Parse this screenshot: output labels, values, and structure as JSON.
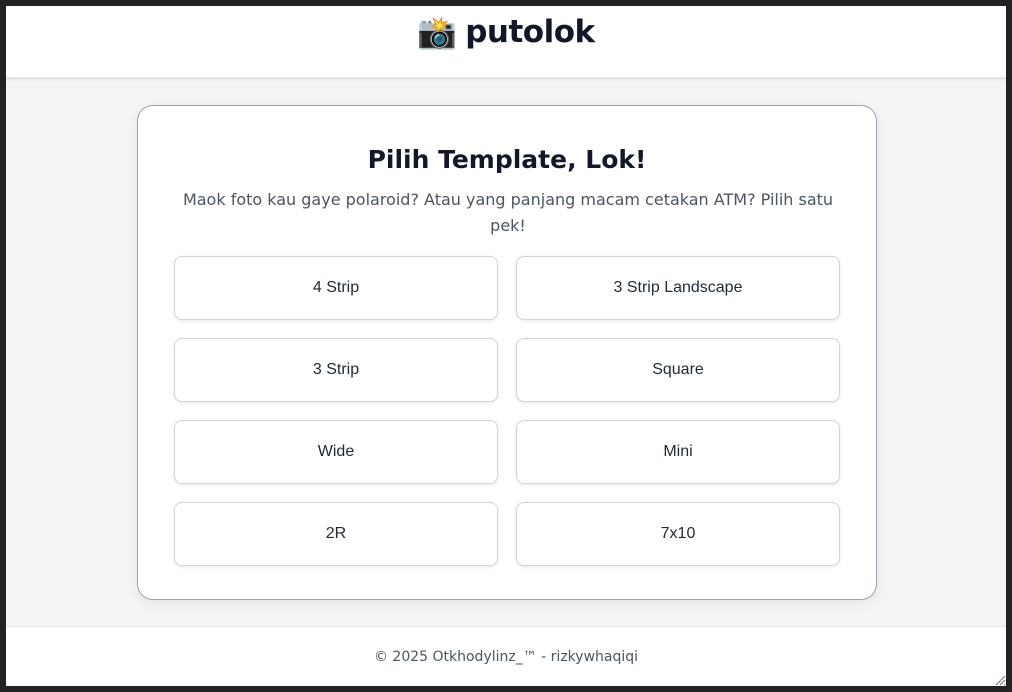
{
  "header": {
    "icon": "camera-flash-icon",
    "icon_glyph": "📸",
    "brand": "putolok"
  },
  "main": {
    "title": "Pilih Template, Lok!",
    "subtitle": "Maok foto kau gaye polaroid? Atau yang panjang macam cetakan ATM? Pilih satu pek!",
    "templates": [
      {
        "label": "4 Strip"
      },
      {
        "label": "3 Strip Landscape"
      },
      {
        "label": "3 Strip"
      },
      {
        "label": "Square"
      },
      {
        "label": "Wide"
      },
      {
        "label": "Mini"
      },
      {
        "label": "2R"
      },
      {
        "label": "7x10"
      }
    ]
  },
  "footer": {
    "text": "© 2025 Otkhodylinz_™ - rizkywhaqiqi"
  },
  "colors": {
    "frame": "#222222",
    "background": "#f3f4f6",
    "card": "#ffffff",
    "text_primary": "#111827",
    "text_secondary": "#4b5563"
  }
}
